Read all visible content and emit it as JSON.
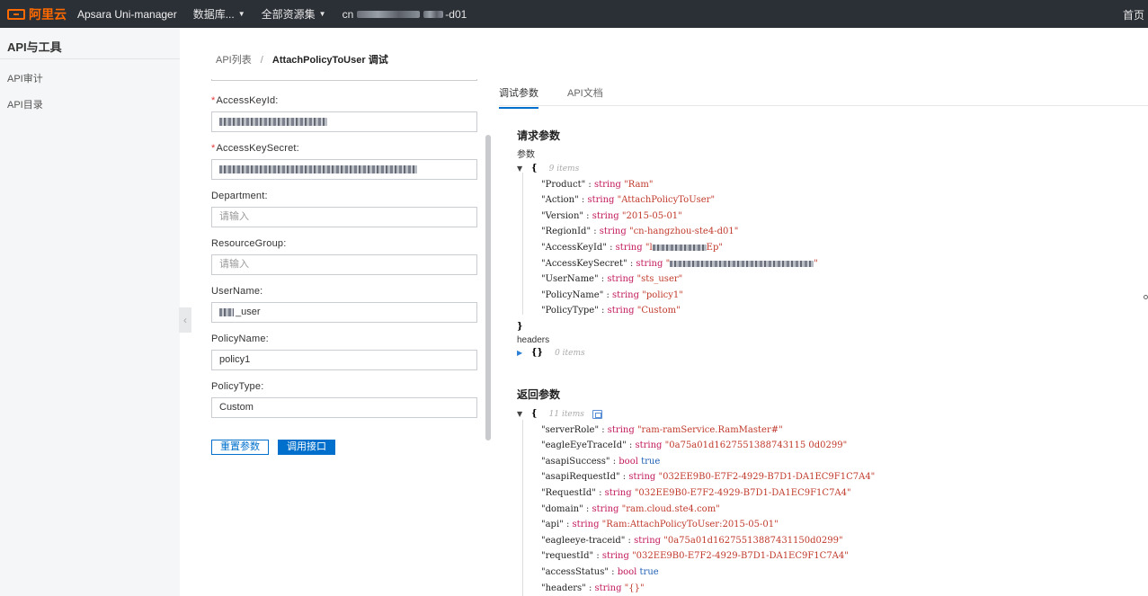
{
  "topbar": {
    "logo_text": "阿里云",
    "product": "Apsara Uni-manager",
    "nav_db": "数据库...",
    "nav_resources": "全部资源集",
    "region_prefix": "cn",
    "region_suffix": "-d01",
    "home": "首页"
  },
  "sidebar": {
    "title": "API与工具",
    "items": [
      "API审计",
      "API目录"
    ]
  },
  "breadcrumb": {
    "parent": "API列表",
    "separator": "/",
    "current": "AttachPolicyToUser 调试"
  },
  "form": {
    "fields": [
      {
        "label": "AccessKeyId:",
        "required": true,
        "value": "",
        "placeholder": ""
      },
      {
        "label": "AccessKeySecret:",
        "required": true,
        "value": "",
        "placeholder": ""
      },
      {
        "label": "Department:",
        "required": false,
        "value": "",
        "placeholder": "请输入"
      },
      {
        "label": "ResourceGroup:",
        "required": false,
        "value": "",
        "placeholder": "请输入"
      },
      {
        "label": "UserName:",
        "required": false,
        "value": "_user",
        "placeholder": ""
      },
      {
        "label": "PolicyName:",
        "required": false,
        "value": "policy1",
        "placeholder": ""
      },
      {
        "label": "PolicyType:",
        "required": false,
        "value": "Custom",
        "placeholder": ""
      }
    ],
    "reset_button": "重置参数",
    "call_button": "调用接口"
  },
  "tabs": [
    "调试参数",
    "API文档"
  ],
  "request": {
    "title": "请求参数",
    "params_label": "参数",
    "count": "9 items",
    "entries": [
      {
        "key": "\"Product\"",
        "type": "string",
        "value": "\"Ram\""
      },
      {
        "key": "\"Action\"",
        "type": "string",
        "value": "\"AttachPolicyToUser\""
      },
      {
        "key": "\"Version\"",
        "type": "string",
        "value": "\"2015-05-01\""
      },
      {
        "key": "\"RegionId\"",
        "type": "string",
        "value": "\"cn-hangzhou-ste4-d01\""
      },
      {
        "key": "\"AccessKeyId\"",
        "type": "string",
        "value": "\"l",
        "redacted_tail": "Ep\""
      },
      {
        "key": "\"AccessKeySecret\"",
        "type": "string",
        "value": "\"",
        "redacted_tail": "\""
      },
      {
        "key": "\"UserName\"",
        "type": "string",
        "value": "\"sts_user\""
      },
      {
        "key": "\"PolicyName\"",
        "type": "string",
        "value": "\"policy1\""
      },
      {
        "key": "\"PolicyType\"",
        "type": "string",
        "value": "\"Custom\""
      }
    ],
    "headers_label": "headers",
    "headers_count": "0 items"
  },
  "response": {
    "title": "返回参数",
    "count": "11 items",
    "entries": [
      {
        "key": "\"serverRole\"",
        "type": "string",
        "value": "\"ram-ramService.RamMaster#\"",
        "kind": "str"
      },
      {
        "key": "\"eagleEyeTraceId\"",
        "type": "string",
        "value": "\"0a75a01d1627551388743115 0d0299\"",
        "kind": "str"
      },
      {
        "key": "\"asapiSuccess\"",
        "type": "bool",
        "value": "true",
        "kind": "bool"
      },
      {
        "key": "\"asapiRequestId\"",
        "type": "string",
        "value": "\"032EE9B0-E7F2-4929-B7D1-DA1EC9F1C7A4\"",
        "kind": "str"
      },
      {
        "key": "\"RequestId\"",
        "type": "string",
        "value": "\"032EE9B0-E7F2-4929-B7D1-DA1EC9F1C7A4\"",
        "kind": "str"
      },
      {
        "key": "\"domain\"",
        "type": "string",
        "value": "\"ram.cloud.ste4.com\"",
        "kind": "str"
      },
      {
        "key": "\"api\"",
        "type": "string",
        "value": "\"Ram:AttachPolicyToUser:2015-05-01\"",
        "kind": "str"
      },
      {
        "key": "\"eagleeye-traceid\"",
        "type": "string",
        "value": "\"0a75a01d16275513887431150d0299\"",
        "kind": "str"
      },
      {
        "key": "\"requestId\"",
        "type": "string",
        "value": "\"032EE9B0-E7F2-4929-B7D1-DA1EC9F1C7A4\"",
        "kind": "str"
      },
      {
        "key": "\"accessStatus\"",
        "type": "bool",
        "value": "true",
        "kind": "bool"
      },
      {
        "key": "\"headers\"",
        "type": "string",
        "value": "\"{}\"",
        "kind": "str"
      }
    ]
  },
  "colors": {
    "topbar": "#2b2f36",
    "brand": "#ff6a00",
    "primary": "#0070cc",
    "json_string": "#c0392b",
    "json_type": "#c2185b",
    "json_bool": "#1f5fb4"
  }
}
